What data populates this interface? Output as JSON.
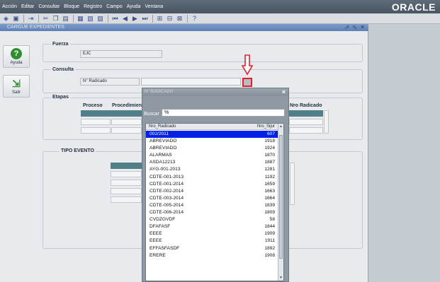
{
  "menu": [
    "Acción",
    "Editar",
    "Consultar",
    "Bloque",
    "Registro",
    "Campo",
    "Ayuda",
    "Ventana"
  ],
  "brand": "ORACLE",
  "toolbar_icons": [
    "save-icon",
    "print-icon",
    "exit-icon",
    "cut-icon",
    "copy-icon",
    "paste-icon",
    "enter-query-icon",
    "execute-query-icon",
    "cancel-query-icon",
    "first-record-icon",
    "previous-record-icon",
    "next-record-icon",
    "last-record-icon",
    "insert-record-icon",
    "delete-record-icon",
    "clear-record-icon",
    "help-icon"
  ],
  "window": {
    "title": "CARGUE EXPEDIENTES",
    "controls": "⬀ ⬁ ✕"
  },
  "sidebar": {
    "help_label": "Ayuda",
    "exit_label": "Salir"
  },
  "fuerza": {
    "title": "Fuerza",
    "value": "EJC"
  },
  "consulta": {
    "title": "Consulta",
    "label_value": "N° Radicado",
    "value": ""
  },
  "etapas": {
    "title": "Etapas",
    "col_proceso": "Proceso",
    "col_procedimiento": "Procedimien",
    "col_nro_radicado": "Nro Radicado"
  },
  "tipo_evento": {
    "title": "TIPO EVENTO"
  },
  "dialog": {
    "title": "N° RADICADO",
    "search_label": "Buscar",
    "search_value": "%",
    "col_nro_radicado": "Nro_Radicado",
    "col_nro_sijur": "Nro_Sijur",
    "rows": [
      {
        "radicado": "002/2011",
        "sijur": "607"
      },
      {
        "radicado": "ABREVIADO",
        "sijur": "1918"
      },
      {
        "radicado": "ABREVIADO",
        "sijur": "1924"
      },
      {
        "radicado": "ALARMAS",
        "sijur": "1870"
      },
      {
        "radicado": "ASDA12213",
        "sijur": "1887"
      },
      {
        "radicado": "AYG-001-2013",
        "sijur": "1281"
      },
      {
        "radicado": "CDTE-001-2013",
        "sijur": "1192"
      },
      {
        "radicado": "CDTE-001-2014",
        "sijur": "1659"
      },
      {
        "radicado": "CDTE-002-2014",
        "sijur": "1663"
      },
      {
        "radicado": "CDTE-003-2014",
        "sijur": "1664"
      },
      {
        "radicado": "CDTE-005-2014",
        "sijur": "1839"
      },
      {
        "radicado": "CDTE-006-2014",
        "sijur": "1809"
      },
      {
        "radicado": "CVDZGVDF",
        "sijur": "58"
      },
      {
        "radicado": "DFAFASF",
        "sijur": "1844"
      },
      {
        "radicado": "EEEE",
        "sijur": "1909"
      },
      {
        "radicado": "EEEE",
        "sijur": "1911"
      },
      {
        "radicado": "EFFASFASDF",
        "sijur": "1892"
      },
      {
        "radicado": "ERERE",
        "sijur": "1908"
      }
    ],
    "selected_index": 0
  },
  "colors": {
    "selection": "#0020e6",
    "teal_header": "#517f89",
    "highlight": "#e0202a"
  }
}
